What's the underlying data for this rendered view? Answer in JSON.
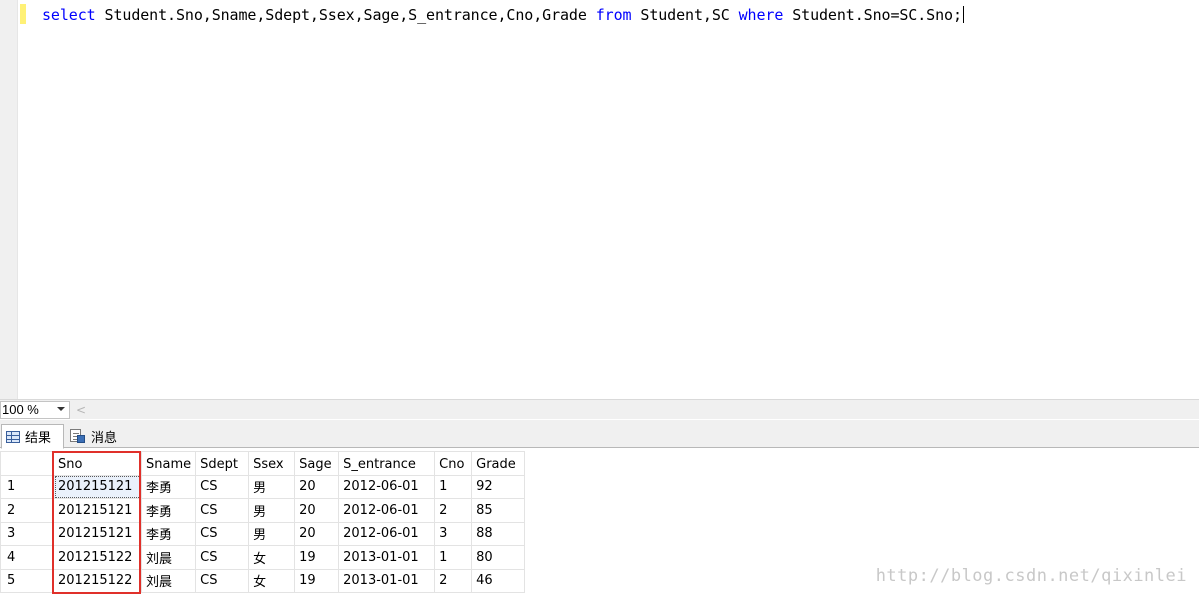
{
  "editor": {
    "tokens": [
      {
        "text": "select",
        "kind": "keyword"
      },
      {
        "text": " Student.Sno,Sname,Sdept,Ssex,Sage,S_entrance,Cno,Grade ",
        "kind": "text"
      },
      {
        "text": "from",
        "kind": "keyword"
      },
      {
        "text": " Student,SC ",
        "kind": "text"
      },
      {
        "text": "where",
        "kind": "keyword"
      },
      {
        "text": " Student.Sno=SC.Sno;",
        "kind": "text"
      }
    ],
    "keyword_color": "#0000ff"
  },
  "zoom": {
    "value": "100 %",
    "scroll_left_glyph": "<"
  },
  "tabs": [
    {
      "label": "结果",
      "icon": "grid-icon",
      "active": true
    },
    {
      "label": "消息",
      "icon": "message-icon",
      "active": false
    }
  ],
  "grid": {
    "columns": [
      "Sno",
      "Sname",
      "Sdept",
      "Ssex",
      "Sage",
      "S_entrance",
      "Cno",
      "Grade"
    ],
    "rows": [
      {
        "n": "1",
        "cells": [
          "201215121",
          "李勇",
          "CS",
          "男",
          "20",
          "2012-06-01",
          "1",
          "92"
        ]
      },
      {
        "n": "2",
        "cells": [
          "201215121",
          "李勇",
          "CS",
          "男",
          "20",
          "2012-06-01",
          "2",
          "85"
        ]
      },
      {
        "n": "3",
        "cells": [
          "201215121",
          "李勇",
          "CS",
          "男",
          "20",
          "2012-06-01",
          "3",
          "88"
        ]
      },
      {
        "n": "4",
        "cells": [
          "201215122",
          "刘晨",
          "CS",
          "女",
          "19",
          "2013-01-01",
          "1",
          "80"
        ]
      },
      {
        "n": "5",
        "cells": [
          "201215122",
          "刘晨",
          "CS",
          "女",
          "19",
          "2013-01-01",
          "2",
          "46"
        ]
      }
    ],
    "highlight_color": "#e0302a"
  },
  "watermark": "http://blog.csdn.net/qixinlei"
}
